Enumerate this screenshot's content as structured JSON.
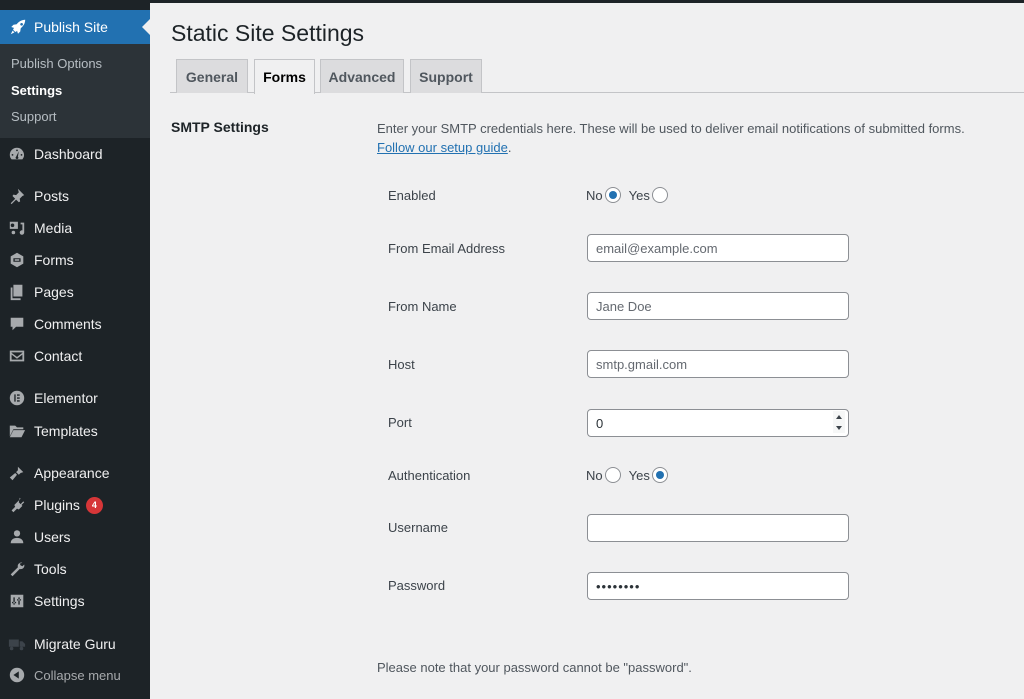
{
  "sidebar": {
    "current": {
      "label": "Publish Site",
      "icon": "rocket-icon"
    },
    "submenu": [
      {
        "label": "Publish Options",
        "active": false
      },
      {
        "label": "Settings",
        "active": true
      },
      {
        "label": "Support",
        "active": false
      }
    ],
    "items": [
      {
        "label": "Dashboard",
        "icon": "dashboard-icon"
      },
      {
        "label": "Posts",
        "icon": "pin-icon"
      },
      {
        "label": "Media",
        "icon": "media-icon"
      },
      {
        "label": "Forms",
        "icon": "forms-icon"
      },
      {
        "label": "Pages",
        "icon": "pages-icon"
      },
      {
        "label": "Comments",
        "icon": "comment-icon"
      },
      {
        "label": "Contact",
        "icon": "envelope-icon"
      },
      {
        "label": "Elementor",
        "icon": "elementor-icon"
      },
      {
        "label": "Templates",
        "icon": "folder-icon"
      },
      {
        "label": "Appearance",
        "icon": "paintbrush-icon"
      },
      {
        "label": "Plugins",
        "icon": "plugin-icon",
        "badge": "4"
      },
      {
        "label": "Users",
        "icon": "user-icon"
      },
      {
        "label": "Tools",
        "icon": "wrench-icon"
      },
      {
        "label": "Settings",
        "icon": "sliders-icon"
      },
      {
        "label": "Migrate Guru",
        "icon": "truck-icon"
      },
      {
        "label": "Collapse menu",
        "icon": "collapse-arrow-icon"
      }
    ]
  },
  "main": {
    "title": "Static Site Settings",
    "tabs": [
      {
        "label": "General",
        "active": false
      },
      {
        "label": "Forms",
        "active": true
      },
      {
        "label": "Advanced",
        "active": false
      },
      {
        "label": "Support",
        "active": false
      }
    ],
    "section_title": "SMTP Settings",
    "description": "Enter your SMTP credentials here. These will be used to deliver email notifications of submitted forms.",
    "guide_link": "Follow our setup guide",
    "guide_suffix": ".",
    "fields": {
      "enabled": {
        "label": "Enabled",
        "options": [
          "No",
          "Yes"
        ],
        "selected": "No"
      },
      "from_email": {
        "label": "From Email Address",
        "value": "",
        "placeholder": "email@example.com"
      },
      "from_name": {
        "label": "From Name",
        "value": "",
        "placeholder": "Jane Doe"
      },
      "host": {
        "label": "Host",
        "value": "",
        "placeholder": "smtp.gmail.com"
      },
      "port": {
        "label": "Port",
        "value": "0"
      },
      "authentication": {
        "label": "Authentication",
        "options": [
          "No",
          "Yes"
        ],
        "selected": "Yes"
      },
      "username": {
        "label": "Username",
        "value": ""
      },
      "password": {
        "label": "Password",
        "value": "password"
      }
    },
    "note": "Please note that your password cannot be \"password\"."
  },
  "colors": {
    "sidebar_bg": "#1d2327",
    "submenu_bg": "#2c3338",
    "accent": "#2271b1",
    "badge": "#d63638",
    "page_bg": "#f0f0f1"
  }
}
